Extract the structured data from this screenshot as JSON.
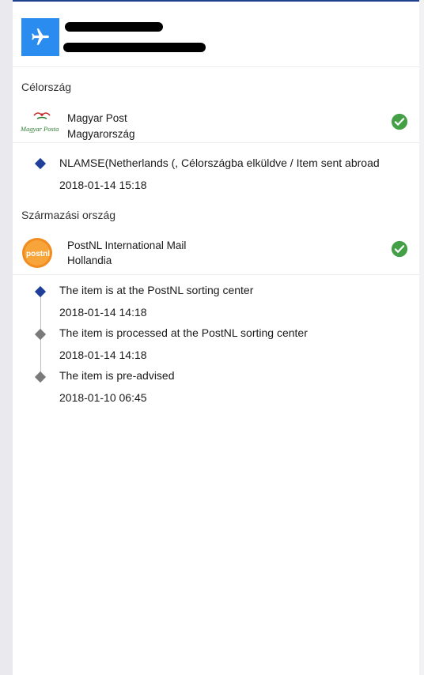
{
  "header": {
    "app_icon": "airplane-icon",
    "accent": "#2b8cf0"
  },
  "destination": {
    "section_label": "Célország",
    "carrier_name": "Magyar Post",
    "carrier_country": "Magyarország",
    "logo_text": "Magyar Posta",
    "status_icon": "check-circle-icon",
    "events": [
      {
        "text": "NLAMSE(Netherlands (, Célországba elküldve / Item sent abroad",
        "time": "2018-01-14 15:18",
        "color": "#1f3f9a"
      }
    ]
  },
  "origin": {
    "section_label": "Származási ország",
    "carrier_name": "PostNL International Mail",
    "carrier_country": "Hollandia",
    "logo_text": "postnl",
    "status_icon": "check-circle-icon",
    "events": [
      {
        "text": "The item is at the PostNL sorting center",
        "time": "2018-01-14 14:18",
        "color": "#1f3f9a"
      },
      {
        "text": "The item is processed at the PostNL sorting center",
        "time": "2018-01-14 14:18",
        "color": "#7a7a7a"
      },
      {
        "text": "The item is pre-advised",
        "time": "2018-01-10 06:45",
        "color": "#7a7a7a"
      }
    ]
  },
  "colors": {
    "check_green": "#43a047",
    "header_border": "#1f3f8f"
  }
}
